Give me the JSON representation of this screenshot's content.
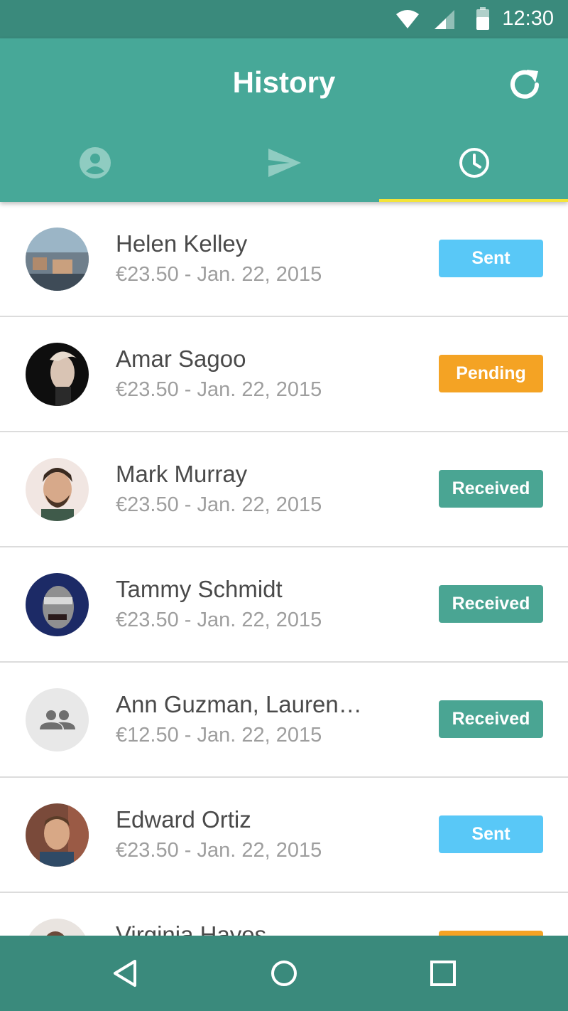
{
  "status_bar": {
    "time": "12:30",
    "icons": [
      "wifi-icon",
      "cell-signal-icon",
      "battery-icon"
    ]
  },
  "app_bar": {
    "title": "History",
    "refresh_icon": "refresh-icon"
  },
  "tabs": [
    {
      "icon": "account-circle-icon",
      "active": false
    },
    {
      "icon": "send-icon",
      "active": false
    },
    {
      "icon": "clock-icon",
      "active": true
    }
  ],
  "colors": {
    "status_bar": "#3a8a7c",
    "app_bar": "#47a898",
    "tab_indicator": "#f4e43a",
    "sent": "#59c8f7",
    "pending": "#f4a324",
    "received": "#4aa593"
  },
  "history": [
    {
      "name": "Helen Kelley",
      "detail": "€23.50 - Jan. 22, 2015",
      "status": "Sent",
      "status_key": "sent",
      "avatar": "landscape-photo"
    },
    {
      "name": "Amar Sagoo",
      "detail": "€23.50 - Jan. 22, 2015",
      "status": "Pending",
      "status_key": "pending",
      "avatar": "profile-photo"
    },
    {
      "name": "Mark Murray",
      "detail": "€23.50 - Jan. 22, 2015",
      "status": "Received",
      "status_key": "received",
      "avatar": "profile-photo"
    },
    {
      "name": "Tammy Schmidt",
      "detail": "€23.50 - Jan. 22, 2015",
      "status": "Received",
      "status_key": "received",
      "avatar": "profile-photo"
    },
    {
      "name": "Ann Guzman, Lauren…",
      "detail": "€12.50 - Jan. 22, 2015",
      "status": "Received",
      "status_key": "received",
      "avatar": "group-icon"
    },
    {
      "name": "Edward Ortiz",
      "detail": "€23.50 - Jan. 22, 2015",
      "status": "Sent",
      "status_key": "sent",
      "avatar": "profile-photo"
    },
    {
      "name": "Virginia Hayes",
      "detail": "",
      "status": "",
      "status_key": "pending",
      "avatar": "profile-photo"
    }
  ],
  "nav_bar": {
    "icons": [
      "back-icon",
      "home-icon",
      "recents-icon"
    ]
  }
}
